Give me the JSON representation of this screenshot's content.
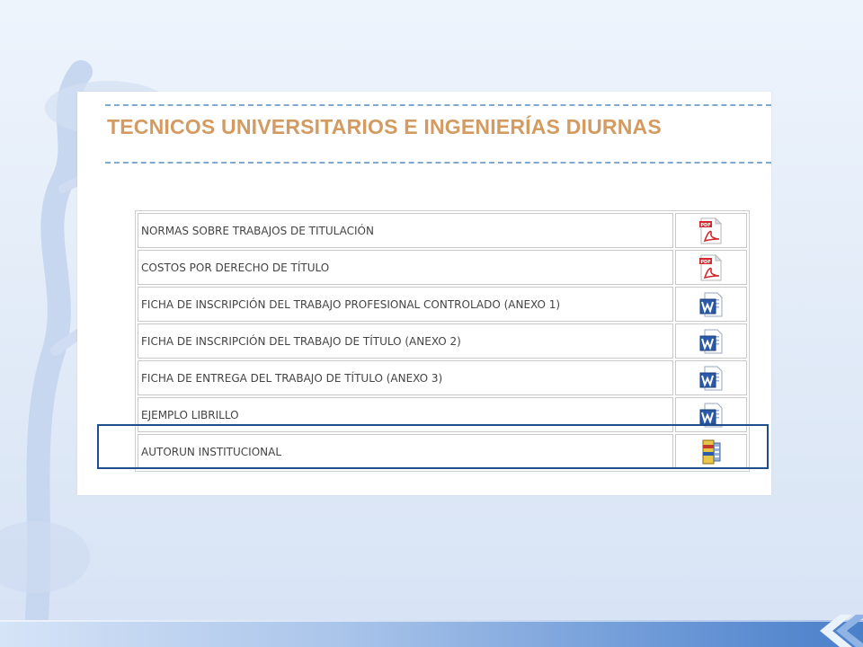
{
  "page": {
    "title": "TECNICOS UNIVERSITARIOS E INGENIERÍAS DIURNAS"
  },
  "colors": {
    "title": "#d39b61",
    "dash": "#7fa9d2",
    "highlight": "#1f4e8f",
    "pdf_red": "#d2282e",
    "word_blue": "#2a5aa8"
  },
  "documents": [
    {
      "label": "NORMAS SOBRE TRABAJOS DE TITULACIÓN",
      "icon": "pdf-icon"
    },
    {
      "label": "COSTOS POR DERECHO DE TÍTULO",
      "icon": "pdf-icon"
    },
    {
      "label": "FICHA DE INSCRIPCIÓN DEL TRABAJO PROFESIONAL CONTROLADO (ANEXO 1)",
      "icon": "word-icon"
    },
    {
      "label": "FICHA DE INSCRIPCIÓN DEL TRABAJO DE TÍTULO (ANEXO 2)",
      "icon": "word-icon"
    },
    {
      "label": "FICHA DE ENTREGA DEL TRABAJO DE TÍTULO (ANEXO 3)",
      "icon": "word-icon"
    },
    {
      "label": "EJEMPLO LIBRILLO",
      "icon": "word-icon"
    },
    {
      "label": "AUTORUN INSTITUCIONAL",
      "icon": "archive-icon"
    }
  ],
  "icon_text": {
    "pdf": "PDF"
  }
}
